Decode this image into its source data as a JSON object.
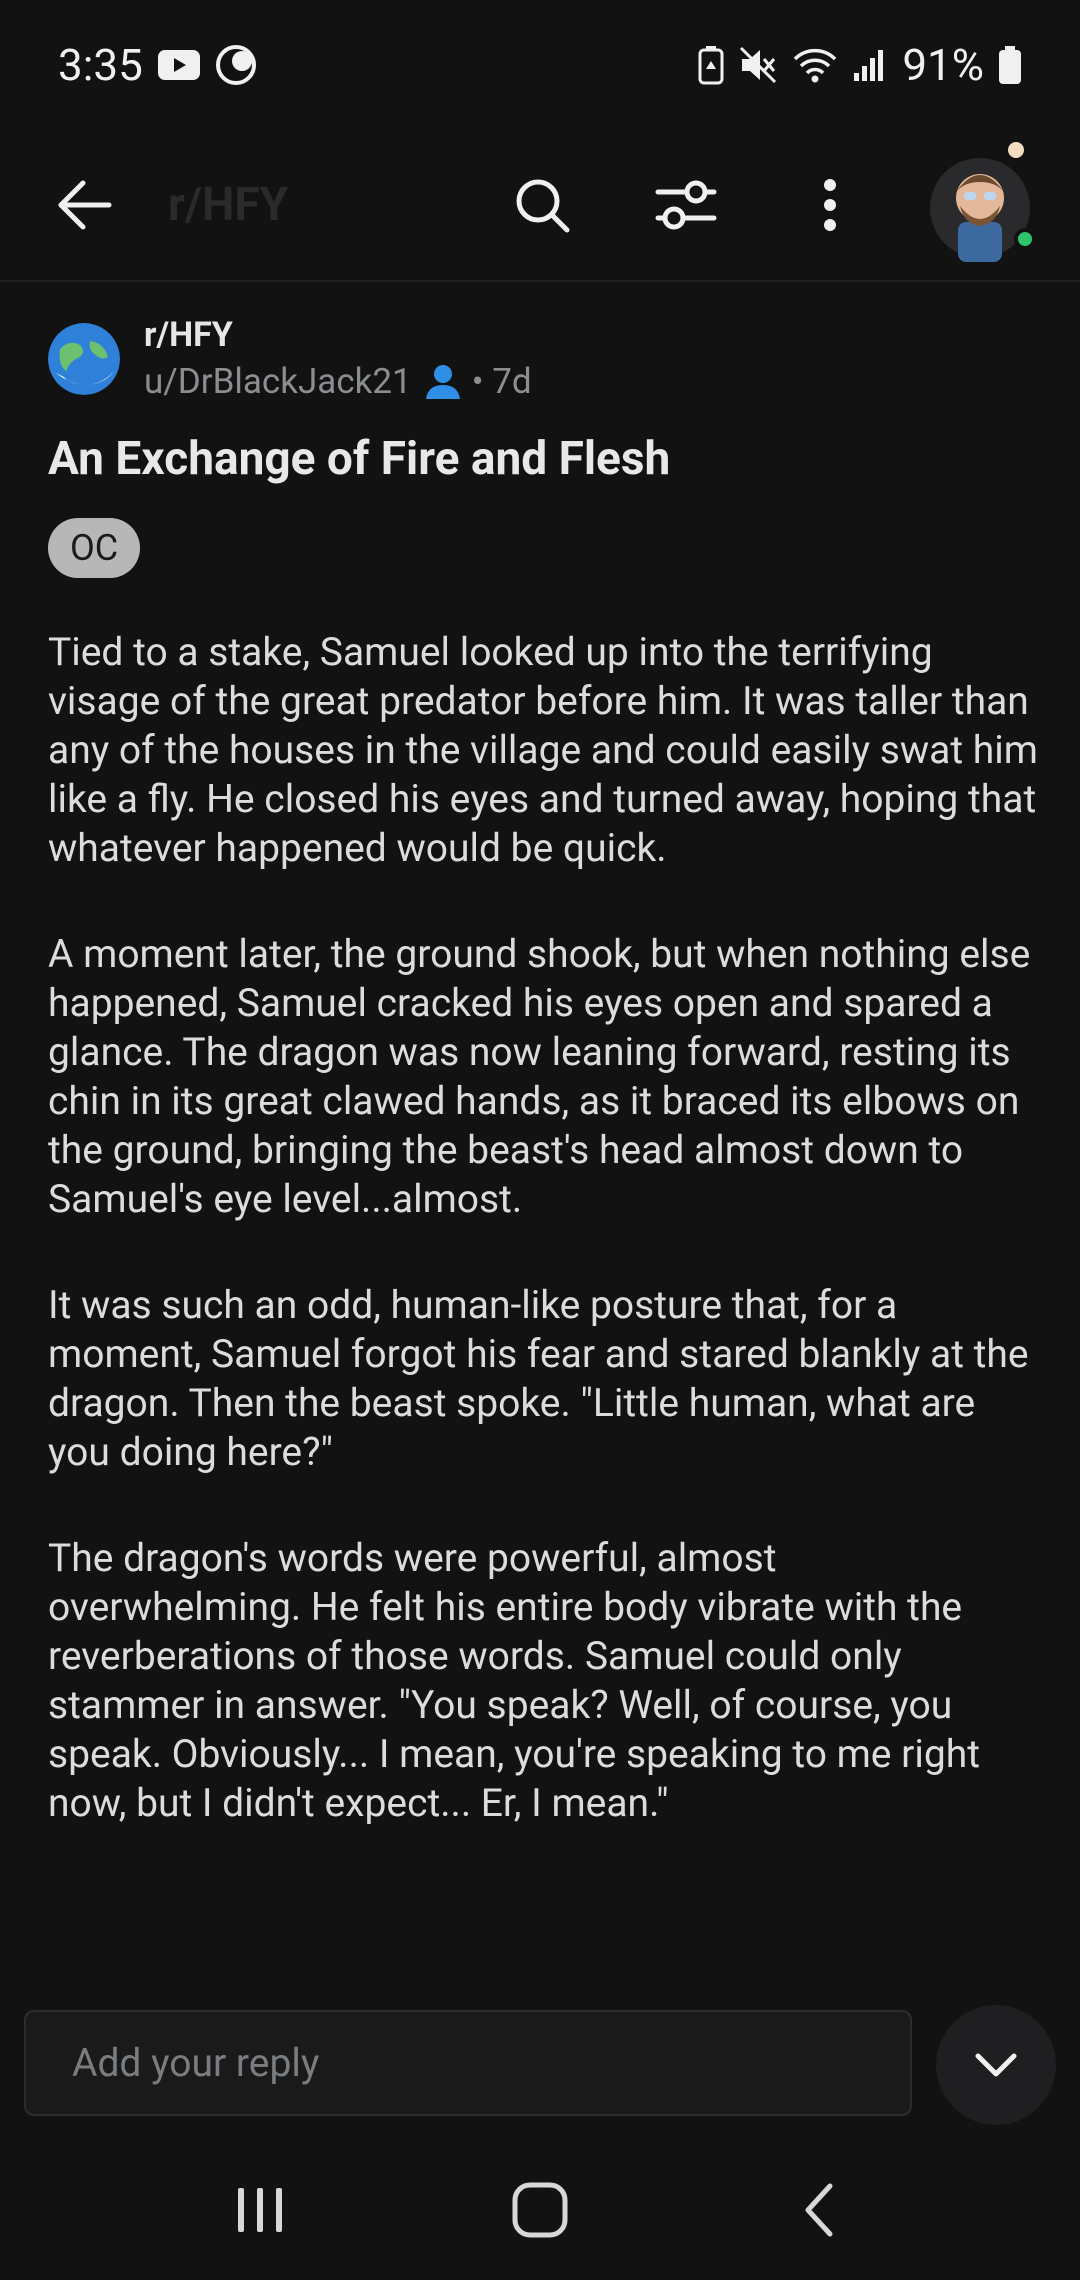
{
  "status_bar": {
    "time": "3:35",
    "battery": "91%",
    "icons": [
      "youtube-icon",
      "crescent-icon",
      "battery-saver-icon",
      "mute-icon",
      "wifi-icon",
      "signal-icon",
      "battery-icon"
    ]
  },
  "app_bar": {
    "subreddit": "r/HFY",
    "icons": [
      "back-arrow-icon",
      "search-icon",
      "filter-icon",
      "more-vert-icon"
    ]
  },
  "post": {
    "subreddit": "r/HFY",
    "author": "u/DrBlackJack21",
    "age": "• 7d",
    "title": "An Exchange of Fire and Flesh",
    "flair": "OC",
    "paragraphs": [
      "Tied to a stake, Samuel looked up into the terrifying visage of the great predator before him. It was taller than any of the houses in the village and could easily swat him like a fly. He closed his eyes and turned away, hoping that whatever happened would be quick.",
      "A moment later, the ground shook, but when nothing else happened, Samuel cracked his eyes open and spared a glance. The dragon was now leaning forward, resting its chin in its great clawed hands, as it braced its elbows on the ground, bringing the beast's head almost down to Samuel's eye level...almost.",
      "It was such an odd, human-like posture that, for a moment, Samuel forgot his fear and stared blankly at the dragon. Then the beast spoke. \"Little human, what are you doing here?\"",
      "The dragon's words were powerful, almost overwhelming. He felt his entire body vibrate with the reverberations of those words. Samuel could only stammer in answer. \"You speak? Well, of course, you speak. Obviously... I mean, you're speaking to me right now, but I didn't expect... Er, I mean.\""
    ]
  },
  "reply": {
    "placeholder": "Add your reply"
  },
  "colors": {
    "background": "#121213",
    "text": "#dcdcdc",
    "flair_bg": "#b7b7b7",
    "user_badge": "#2f8fe6",
    "online": "#2ec46d"
  },
  "nav": {
    "icons": [
      "recents-icon",
      "home-icon",
      "back-icon"
    ]
  }
}
